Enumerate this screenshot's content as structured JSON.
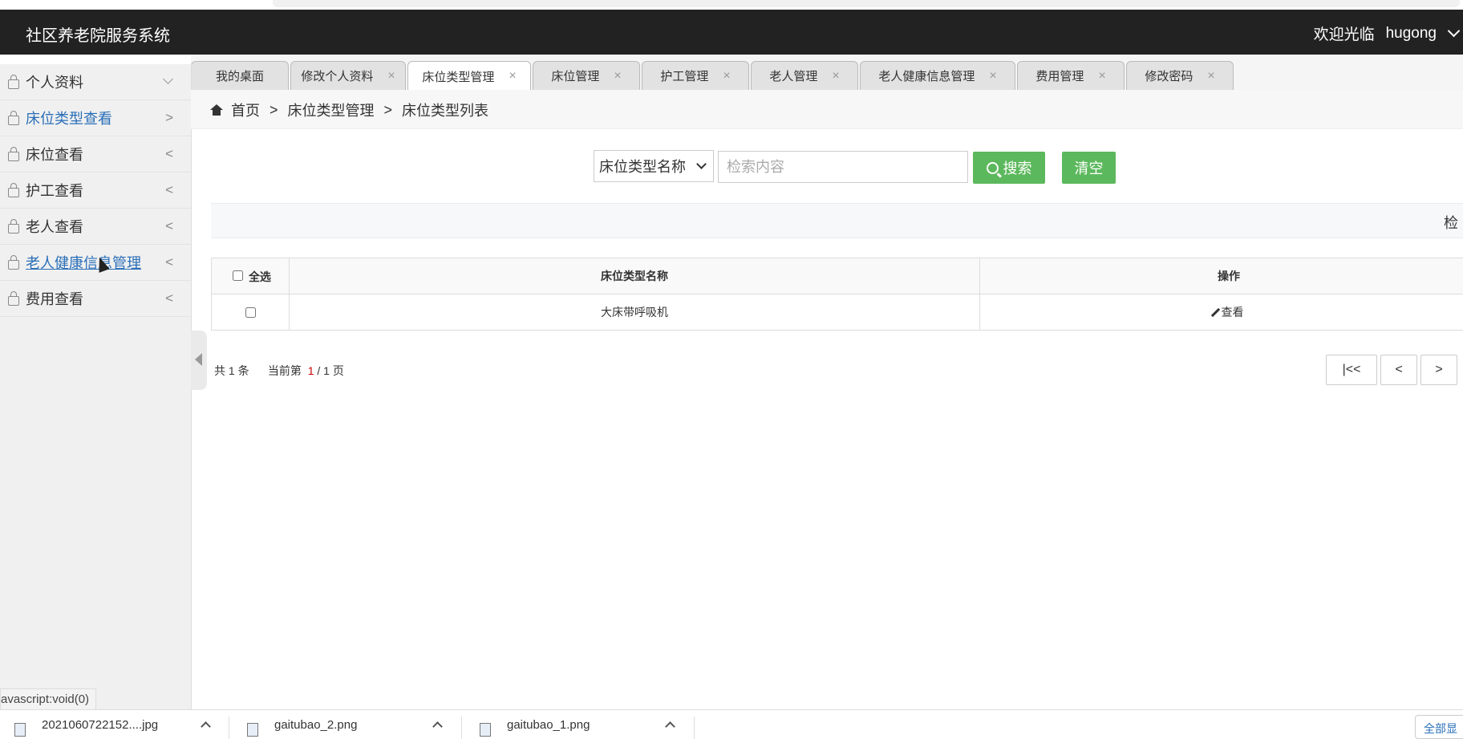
{
  "header": {
    "app_title": "社区养老院服务系统",
    "welcome": "欢迎光临",
    "username": "hugong"
  },
  "sidebar": {
    "items": [
      {
        "label": "个人资料",
        "arrow": "v"
      },
      {
        "label": "床位类型查看",
        "arrow": ">"
      },
      {
        "label": "床位查看",
        "arrow": "<"
      },
      {
        "label": "护工查看",
        "arrow": "<"
      },
      {
        "label": "老人查看",
        "arrow": "<"
      },
      {
        "label": "老人健康信息管理",
        "arrow": "<"
      },
      {
        "label": "费用查看",
        "arrow": "<"
      }
    ]
  },
  "tabs": [
    {
      "label": "我的桌面"
    },
    {
      "label": "修改个人资料",
      "close": "×"
    },
    {
      "label": "床位类型管理",
      "close": "×"
    },
    {
      "label": "床位管理",
      "close": "×"
    },
    {
      "label": "护工管理",
      "close": "×"
    },
    {
      "label": "老人管理",
      "close": "×"
    },
    {
      "label": "老人健康信息管理",
      "close": "×"
    },
    {
      "label": "费用管理",
      "close": "×"
    },
    {
      "label": "修改密码",
      "close": "×"
    }
  ],
  "breadcrumb": {
    "home": "首页",
    "sep": ">",
    "level1": "床位类型管理",
    "level2": "床位类型列表"
  },
  "search": {
    "field_selected": "床位类型名称",
    "placeholder": "检索内容",
    "search_label": "搜索",
    "clear_label": "清空"
  },
  "info_bar": {
    "text": "检"
  },
  "table": {
    "select_all": "全选",
    "col_name": "床位类型名称",
    "col_action": "操作",
    "rows": [
      {
        "name": "大床带呼吸机",
        "action": "查看"
      }
    ]
  },
  "pagination": {
    "total_prefix": "共",
    "total": "1",
    "total_suffix": "条",
    "current_prefix": "当前第",
    "current": "1",
    "pages": "/ 1 页",
    "first": "|<<",
    "prev": "<",
    "next": ">"
  },
  "status_tip": "avascript:void(0)",
  "downloads": [
    {
      "name": "2021060722152....jpg"
    },
    {
      "name": "gaitubao_2.png"
    },
    {
      "name": "gaitubao_1.png"
    }
  ],
  "downloads_more": "全部显"
}
